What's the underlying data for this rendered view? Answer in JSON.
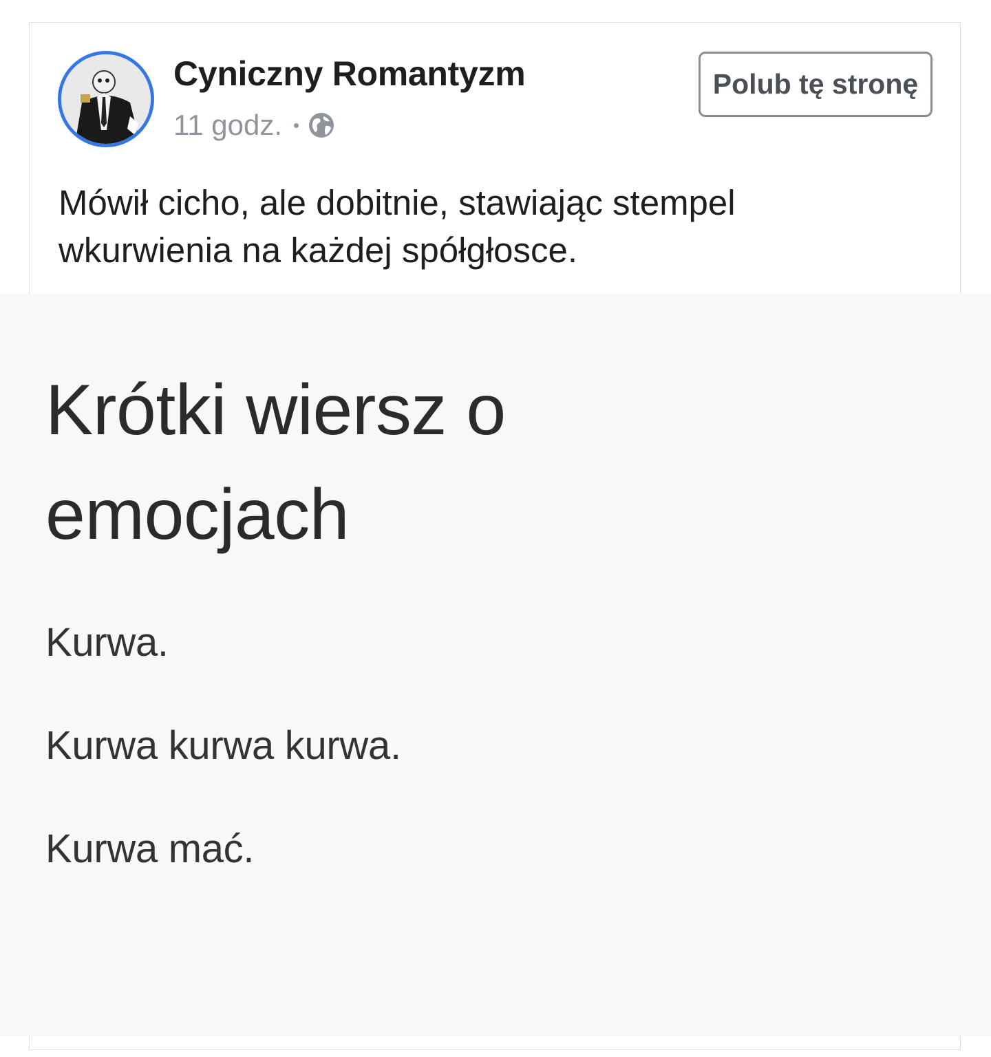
{
  "post": {
    "page_name": "Cyniczny Romantyzm",
    "time": "11 godz.",
    "separator": "•",
    "privacy_icon": "globe-icon",
    "like_button_label": "Polub tę stronę",
    "text_lines": [
      "Mówił cicho, ale dobitnie, stawiając stempel",
      "wkurwienia na każdej spółgłosce."
    ]
  },
  "image": {
    "title_lines": [
      "Krótki wiersz o",
      "emocjach"
    ],
    "poem_lines": [
      "Kurwa.",
      "Kurwa kurwa kurwa.",
      "Kurwa mać."
    ]
  },
  "colors": {
    "avatar_ring": "#3578e5",
    "name_text": "#1c1e21",
    "meta_text": "#90949c",
    "image_background": "#f8f8f8"
  }
}
